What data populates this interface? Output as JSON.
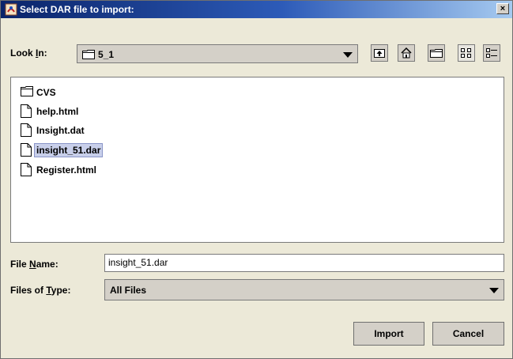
{
  "window": {
    "title": "Select DAR file to import:",
    "close_label": "×"
  },
  "look_in": {
    "label_before": "Look ",
    "label_mnemonic": "I",
    "label_after": "n:",
    "value": "5_1"
  },
  "toolbar": [
    {
      "icon": "up-one-level-icon"
    },
    {
      "icon": "home-icon"
    },
    {
      "icon": "new-folder-icon"
    },
    {
      "icon": "list-view-icon"
    },
    {
      "icon": "details-view-icon"
    }
  ],
  "files": [
    {
      "name": "CVS",
      "type": "folder"
    },
    {
      "name": "help.html",
      "type": "file"
    },
    {
      "name": "Insight.dat",
      "type": "file"
    },
    {
      "name": "insight_51.dar",
      "type": "file",
      "selected": true
    },
    {
      "name": "Register.html",
      "type": "file"
    }
  ],
  "file_name": {
    "label_before": "File ",
    "label_mnemonic": "N",
    "label_after": "ame:",
    "value": "insight_51.dar"
  },
  "file_type": {
    "label_before": "Files of ",
    "label_mnemonic": "T",
    "label_after": "ype:",
    "value": "All Files"
  },
  "buttons": {
    "import": "Import",
    "cancel": "Cancel"
  }
}
